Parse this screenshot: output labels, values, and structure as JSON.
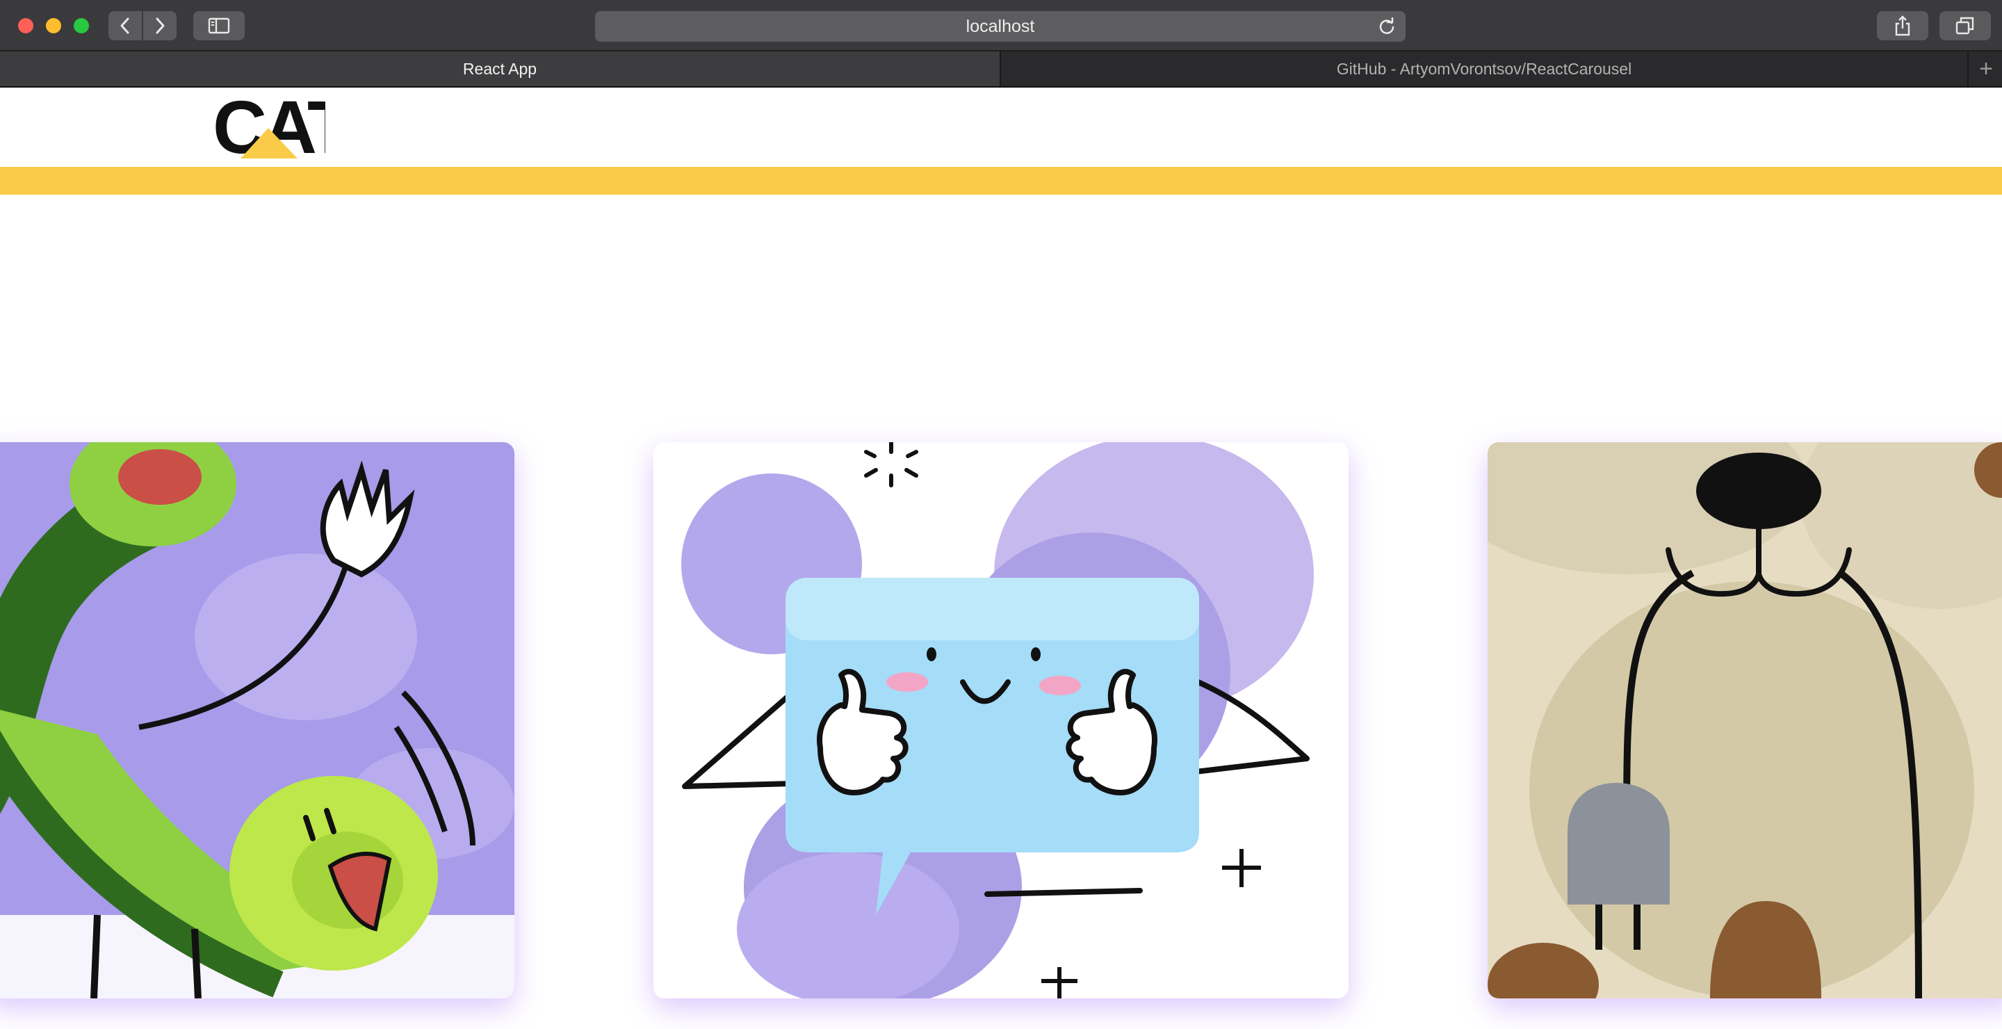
{
  "browser": {
    "url": "localhost",
    "tabs": [
      {
        "label": "React App",
        "active": true
      },
      {
        "label": "GitHub - ArtyomVorontsov/ReactCarousel",
        "active": false
      }
    ]
  },
  "site": {
    "logo_text": "CAT",
    "brand_color": "#f9cb48"
  },
  "carousel": {
    "slides": [
      {
        "illustration": "green-phone-receiver-icon",
        "background": "#a79bea",
        "position": "previous"
      },
      {
        "illustration": "happy-speech-bubble-thumbs-up-icon",
        "background": "#ffffff",
        "position": "current"
      },
      {
        "illustration": "power-plug-bear-icon",
        "background": "#e6dcc2",
        "position": "next"
      }
    ]
  },
  "icons": [
    "back-arrow-icon",
    "forward-arrow-icon",
    "sidebar-icon",
    "reload-icon",
    "share-icon",
    "tabs-overview-icon",
    "plus-icon"
  ]
}
